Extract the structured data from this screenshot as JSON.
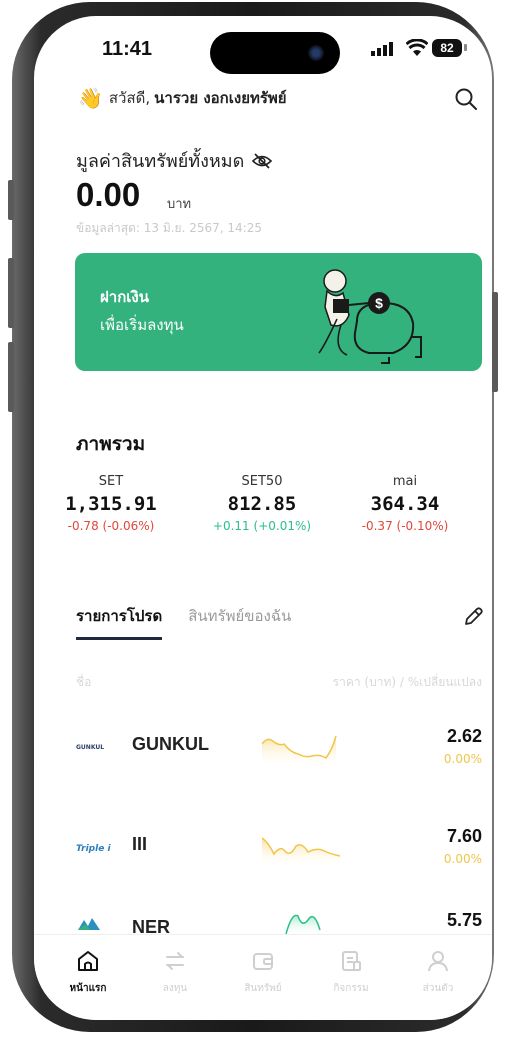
{
  "status_bar": {
    "time": "11:41",
    "battery": "82"
  },
  "header": {
    "greeting": "สวัสดี,",
    "user_name": "นารวย งอกเงยทรัพย์",
    "greeting_icon": "waving-hand-icon",
    "search_icon": "search-icon"
  },
  "assets": {
    "label": "มูลค่าสินทรัพย์ทั้งหมด",
    "value": "0.00",
    "unit": "บาท",
    "updated": "ข้อมูลล่าสุด: 13 มิ.ย. 2567, 14:25",
    "hide_icon": "eye-off-icon"
  },
  "banner": {
    "title": "ฝากเงิน",
    "subtitle": "เพื่อเริ่มลงทุน",
    "color": "#33b27e"
  },
  "overview": {
    "title": "ภาพรวม",
    "indices": [
      {
        "name": "SET",
        "value": "1,315.91",
        "change": "-0.78 (-0.06%)",
        "direction": "down"
      },
      {
        "name": "SET50",
        "value": "812.85",
        "change": "+0.11 (+0.01%)",
        "direction": "up"
      },
      {
        "name": "mai",
        "value": "364.34",
        "change": "-0.37 (-0.10%)",
        "direction": "down"
      }
    ]
  },
  "watchlist": {
    "tabs": [
      {
        "label": "รายการโปรด",
        "active": true
      },
      {
        "label": "สินทรัพย์ของฉัน",
        "active": false
      }
    ],
    "col_name": "ชื่อ",
    "col_price": "ราคา (บาท) / %เปลี่ยนแปลง",
    "items": [
      {
        "logo_text": "GUNKUL",
        "symbol": "GUNKUL",
        "price": "2.62",
        "change": "0.00%"
      },
      {
        "logo_text": "Triple i",
        "symbol": "III",
        "price": "7.60",
        "change": "0.00%"
      },
      {
        "logo_text": "NER",
        "symbol": "NER",
        "price": "5.75",
        "change": ""
      }
    ]
  },
  "bottom_nav": [
    {
      "label": "หน้าแรก",
      "icon": "home-icon",
      "active": true
    },
    {
      "label": "ลงทุน",
      "icon": "transfer-arrows-icon",
      "active": false
    },
    {
      "label": "สินทรัพย์",
      "icon": "wallet-icon",
      "active": false
    },
    {
      "label": "กิจกรรม",
      "icon": "document-icon",
      "active": false
    },
    {
      "label": "ส่วนตัว",
      "icon": "person-icon",
      "active": false
    }
  ],
  "colors": {
    "negative": "#e0473a",
    "positive": "#2bbf8b",
    "accent": "#33b27e",
    "spark": "#f0c64a"
  }
}
